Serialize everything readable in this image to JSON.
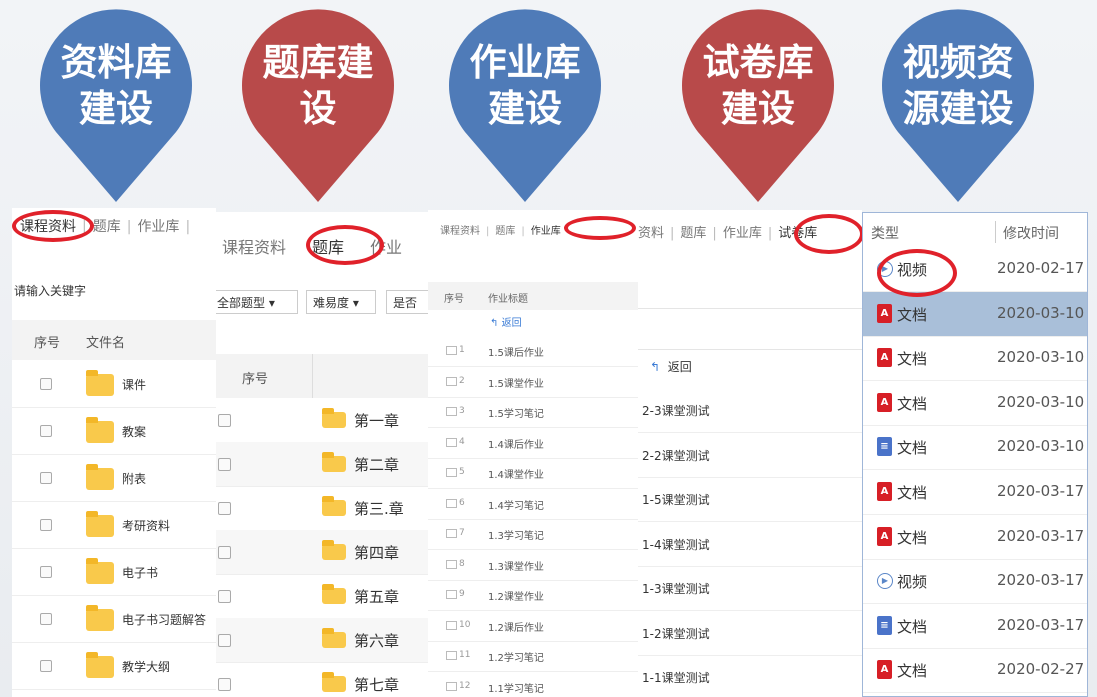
{
  "pins": [
    {
      "label": "资料库\n建设",
      "color": "#4f7bb8"
    },
    {
      "label": "题库建\n设",
      "color": "#b84a4a"
    },
    {
      "label": "作业库\n建设",
      "color": "#4f7bb8"
    },
    {
      "label": "试卷库\n建设",
      "color": "#b84a4a"
    },
    {
      "label": "视频资\n源建设",
      "color": "#4f7bb8"
    }
  ],
  "panel1": {
    "tabs": [
      "课程资料",
      "题库",
      "作业库"
    ],
    "search_placeholder": "请输入关键字",
    "col_index": "序号",
    "col_name": "文件名",
    "files": [
      "课件",
      "教案",
      "附表",
      "考研资料",
      "电子书",
      "电子书习题解答",
      "教学大纲"
    ]
  },
  "panel2": {
    "tabs": [
      "课程资料",
      "题库",
      "作业"
    ],
    "filters": [
      "全部题型 ▾",
      "难易度 ▾",
      "是否"
    ],
    "col_index": "序号",
    "chapters": [
      "第一章",
      "第二章",
      "第三.章",
      "第四章",
      "第五章",
      "第六章",
      "第七章"
    ]
  },
  "panel3": {
    "tabs": [
      "课程资料",
      "题库",
      "作业库"
    ],
    "col_index": "序号",
    "col_title": "作业标题",
    "back": "返回",
    "rows": [
      {
        "n": "1",
        "title": "1.5课后作业"
      },
      {
        "n": "2",
        "title": "1.5课堂作业"
      },
      {
        "n": "3",
        "title": "1.5学习笔记"
      },
      {
        "n": "4",
        "title": "1.4课后作业"
      },
      {
        "n": "5",
        "title": "1.4课堂作业"
      },
      {
        "n": "6",
        "title": "1.4学习笔记"
      },
      {
        "n": "7",
        "title": "1.3学习笔记"
      },
      {
        "n": "8",
        "title": "1.3课堂作业"
      },
      {
        "n": "9",
        "title": "1.2课堂作业"
      },
      {
        "n": "10",
        "title": "1.2课后作业"
      },
      {
        "n": "11",
        "title": "1.2学习笔记"
      },
      {
        "n": "12",
        "title": "1.1学习笔记"
      }
    ]
  },
  "panel4": {
    "tabs": [
      "资料",
      "题库",
      "作业库",
      "试卷库"
    ],
    "back": "返回",
    "tests": [
      "2-3课堂测试",
      "2-2课堂测试",
      "1-5课堂测试",
      "1-4课堂测试",
      "1-3课堂测试",
      "1-2课堂测试",
      "1-1课堂测试"
    ]
  },
  "panel5": {
    "col_type": "类型",
    "col_time": "修改时间",
    "items": [
      {
        "type": "视频",
        "icon": "video",
        "date": "2020-02-17"
      },
      {
        "type": "文档",
        "icon": "pdf",
        "date": "2020-03-10"
      },
      {
        "type": "文档",
        "icon": "pdf",
        "date": "2020-03-10"
      },
      {
        "type": "文档",
        "icon": "pdf",
        "date": "2020-03-10"
      },
      {
        "type": "文档",
        "icon": "word",
        "date": "2020-03-10"
      },
      {
        "type": "文档",
        "icon": "pdf",
        "date": "2020-03-17"
      },
      {
        "type": "文档",
        "icon": "pdf",
        "date": "2020-03-17"
      },
      {
        "type": "视频",
        "icon": "video",
        "date": "2020-03-17"
      },
      {
        "type": "文档",
        "icon": "word",
        "date": "2020-03-17"
      },
      {
        "type": "文档",
        "icon": "pdf",
        "date": "2020-02-27"
      }
    ]
  }
}
